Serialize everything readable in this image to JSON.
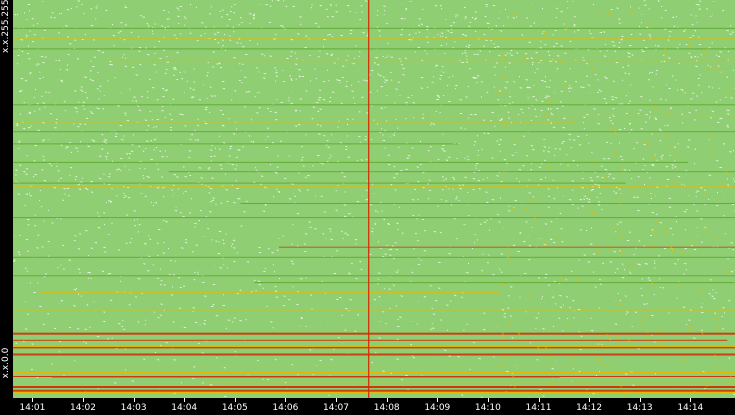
{
  "chart_data": {
    "type": "heatmap",
    "title": "",
    "xlabel": "",
    "ylabel": "",
    "y_tick_labels": [
      "x.x.0.0",
      "x.x.255.255"
    ],
    "x_tick_labels": [
      "14:01",
      "14:02",
      "14:03",
      "14:04",
      "14:05",
      "14:06",
      "14:07",
      "14:08",
      "14:09",
      "14:10",
      "14:11",
      "14:12",
      "14:13",
      "14:14"
    ],
    "x_range": [
      "14:00:37",
      "14:14:53"
    ],
    "y_range": [
      "x.x.0.0",
      "x.x.255.255"
    ],
    "grid": false,
    "legend": "none",
    "event_marker_time": "14:07:38",
    "colors": {
      "background": "#000000",
      "empty_cell": "#ffffff",
      "low": "#8fce72",
      "medium": "#5fa830",
      "high": "#e8b800",
      "peak": "#d62800",
      "axis_text": "#ffffff"
    },
    "color_scale": [
      "empty_cell",
      "low",
      "medium",
      "high",
      "peak"
    ]
  }
}
